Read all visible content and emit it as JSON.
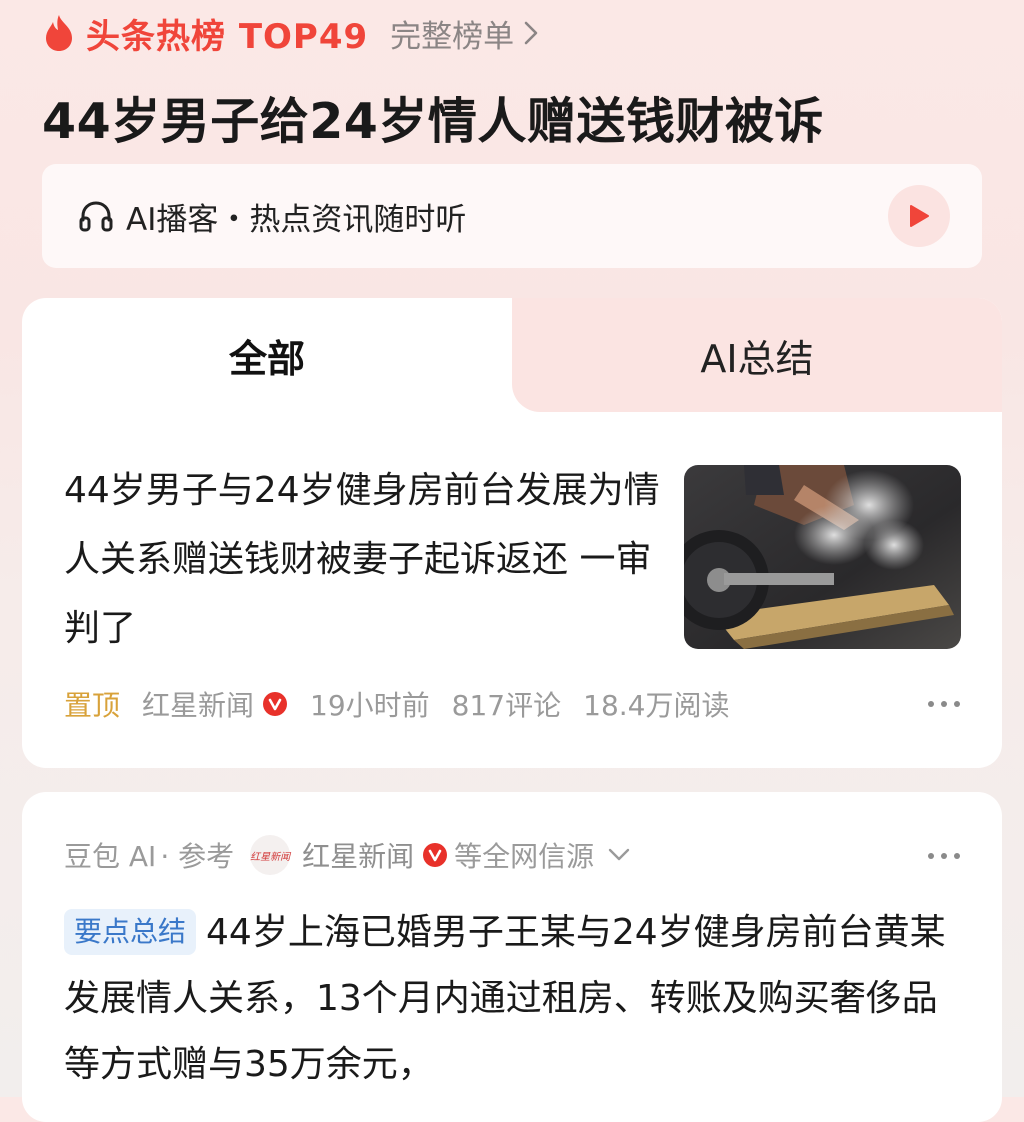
{
  "header": {
    "hot_title": "头条热榜 TOP49",
    "full_list_label": "完整榜单"
  },
  "headline": "44岁男子给24岁情人赠送钱财被诉",
  "podcast": {
    "label": "AI播客・热点资讯随时听"
  },
  "tabs": [
    {
      "label": "全部",
      "active": true
    },
    {
      "label": "AI总结",
      "active": false
    }
  ],
  "article": {
    "title": "44岁男子与24岁健身房前台发展为情人关系赠送钱财被妻子起诉返还 一审判了",
    "pinned_label": "置顶",
    "source": "红星新闻",
    "time": "19小时前",
    "comments": "817评论",
    "reads": "18.4万阅读"
  },
  "summary": {
    "provider": "豆包 AI",
    "reference_label": "· 参考",
    "logo_text": "红星新闻",
    "source": "红星新闻",
    "source_suffix": "等全网信源",
    "keypoint_tag": "要点总结",
    "text": "44岁上海已婚男子王某与24岁健身房前台黄某发展情人关系，13个月内通过租房、转账及购买奢侈品等方式赠与35万余元，"
  },
  "colors": {
    "accent_red": "#f0453a",
    "pinned_gold": "#d8a23a",
    "tag_blue": "#3a78c9"
  }
}
